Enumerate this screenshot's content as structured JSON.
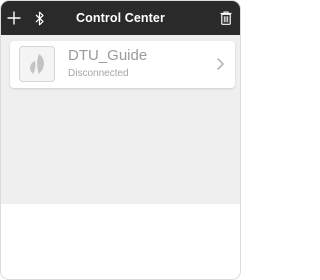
{
  "header": {
    "title": "Control Center",
    "add_icon": "plus-icon",
    "bluetooth_icon": "bluetooth-icon",
    "delete_icon": "trash-icon"
  },
  "devices": [
    {
      "name": "DTU_Guide",
      "status": "Disconnected",
      "icon": "leaf-logo-icon",
      "action_icon": "chevron-right-icon"
    }
  ],
  "colors": {
    "header_bg": "#2a2a2a",
    "content_bg": "#efefef",
    "text_muted": "#9a9a9a"
  }
}
